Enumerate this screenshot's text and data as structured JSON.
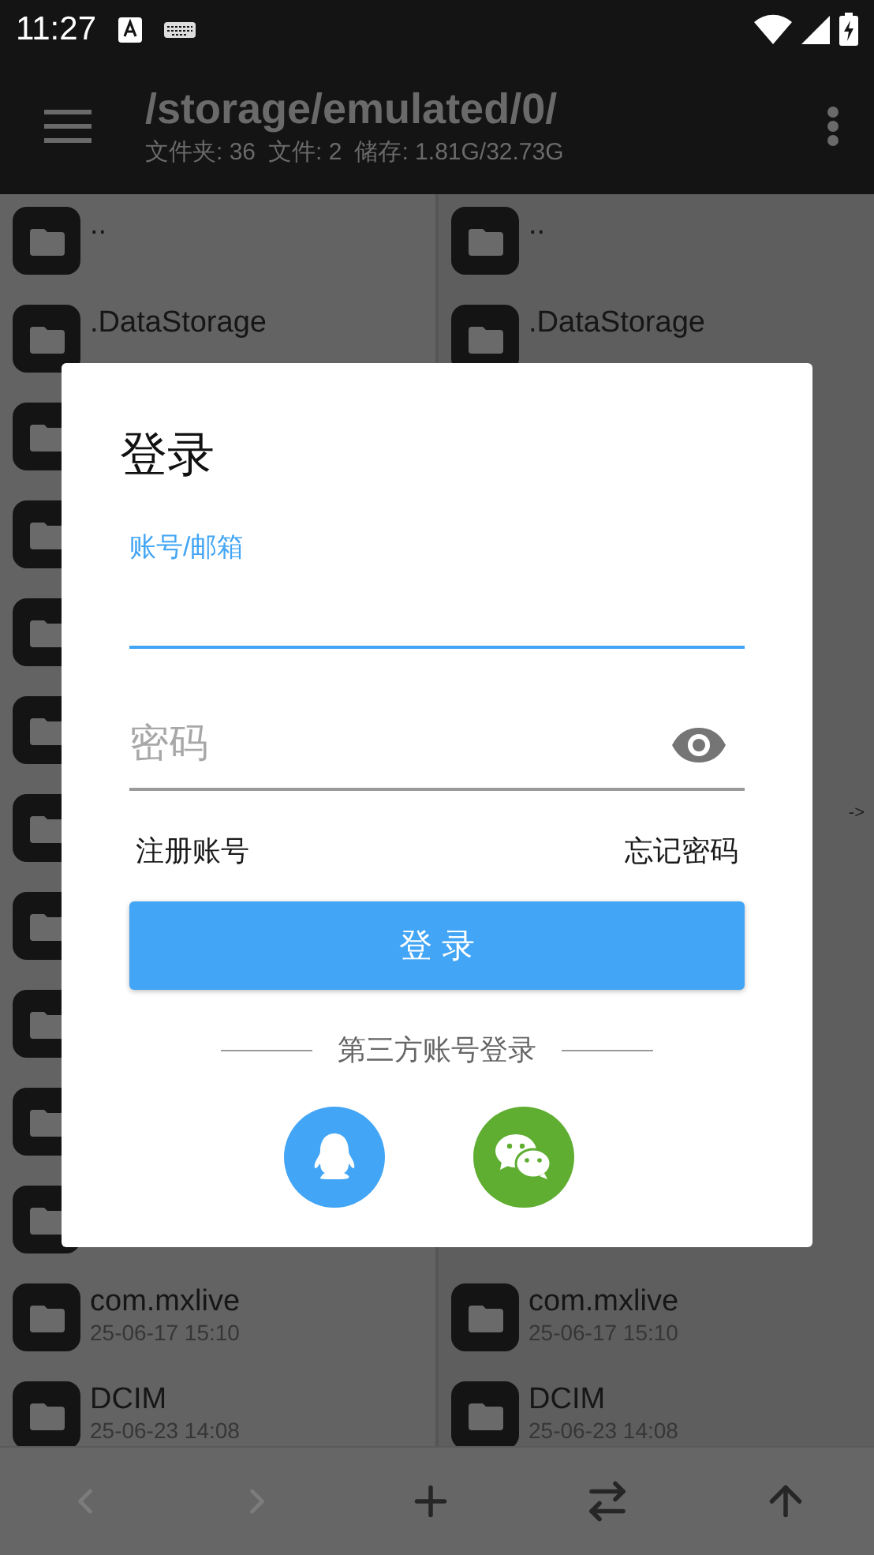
{
  "status_bar": {
    "time": "11:27"
  },
  "app_bar": {
    "path": "/storage/emulated/0/",
    "stats": [
      "文件夹: 36",
      "文件: 2",
      "储存: 1.81G/32.73G"
    ]
  },
  "panes": [
    {
      "rows": [
        {
          "kind": "folder",
          "name": ".."
        },
        {
          "kind": "folder",
          "name": ".DataStorage"
        },
        {
          "kind": "folder"
        },
        {
          "kind": "folder"
        },
        {
          "kind": "folder"
        },
        {
          "kind": "folder"
        },
        {
          "kind": "folder"
        },
        {
          "kind": "folder"
        },
        {
          "kind": "folder"
        },
        {
          "kind": "folder"
        },
        {
          "kind": "folder"
        },
        {
          "kind": "folder",
          "name": "com.mxlive",
          "date": "25-06-17 15:10"
        },
        {
          "kind": "folder",
          "name": "DCIM",
          "date": "25-06-23 14:08"
        }
      ]
    },
    {
      "marker": "->",
      "rows": [
        {
          "kind": "folder",
          "name": ".."
        },
        {
          "kind": "folder",
          "name": ".DataStorage"
        },
        {
          "kind": "covered"
        },
        {
          "kind": "covered"
        },
        {
          "kind": "covered"
        },
        {
          "kind": "covered"
        },
        {
          "kind": "covered"
        },
        {
          "kind": "covered"
        },
        {
          "kind": "covered"
        },
        {
          "kind": "covered"
        },
        {
          "kind": "covered"
        },
        {
          "kind": "folder",
          "name": "com.mxlive",
          "date": "25-06-17 15:10"
        },
        {
          "kind": "folder",
          "name": "DCIM",
          "date": "25-06-23 14:08"
        }
      ]
    }
  ],
  "dialog": {
    "title": "登录",
    "account_field": {
      "label": "账号/邮箱",
      "focused": true
    },
    "password_field": {
      "placeholder": "密码",
      "focused": false
    },
    "links": [
      "注册账号",
      "忘记密码"
    ],
    "login_button": "登 录",
    "third_party": {
      "label": "第三方账号登录",
      "providers": [
        {
          "kind": "qq"
        },
        {
          "kind": "wechat"
        }
      ]
    }
  },
  "bottom_bar": [
    {
      "kind": "back",
      "disabled": true
    },
    {
      "kind": "forward",
      "disabled": true
    },
    {
      "kind": "add",
      "disabled": false
    },
    {
      "kind": "swap",
      "disabled": false
    },
    {
      "kind": "up",
      "disabled": false
    }
  ]
}
